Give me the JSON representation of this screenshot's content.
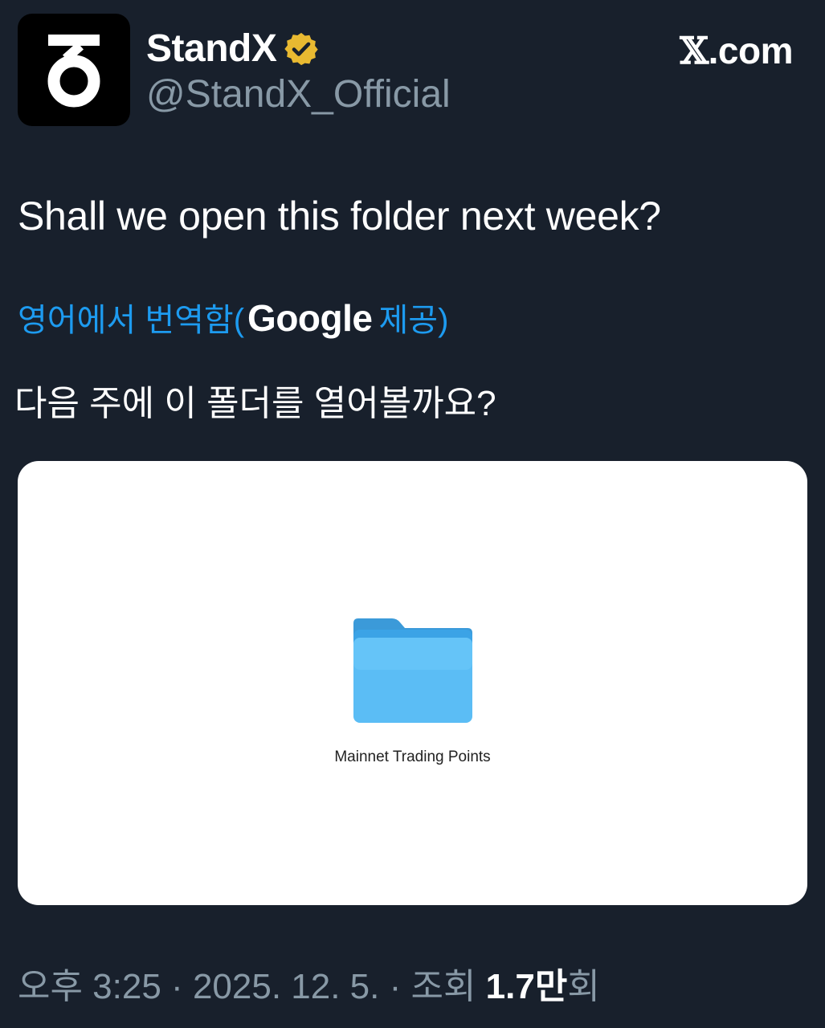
{
  "author": {
    "name": "StandX",
    "handle": "@StandX_Official",
    "avatar_icon": "standx-logo-icon",
    "verified_icon": "verified-badge-icon",
    "verified_color": "#e8b931"
  },
  "brand": {
    "label": ".com",
    "icon": "x-logo-icon"
  },
  "tweet": {
    "text": "Shall we open this folder next week?",
    "translation_prefix": "영어에서 번역함(",
    "translation_provider": "Google",
    "translation_suffix": " 제공)",
    "translated_text": "다음 주에 이 폴더를 열어볼까요?"
  },
  "media": {
    "folder_icon": "folder-icon",
    "folder_label": "Mainnet Trading Points",
    "folder_color": "#5bbdf5"
  },
  "meta": {
    "time": "오후 3:25",
    "separator": " · ",
    "date": "2025. 12. 5.",
    "views_label": "조회 ",
    "views_count": "1.7만",
    "views_suffix": "회"
  },
  "colors": {
    "background": "#18202c",
    "link": "#1d9bf0",
    "muted": "#8899a6"
  }
}
